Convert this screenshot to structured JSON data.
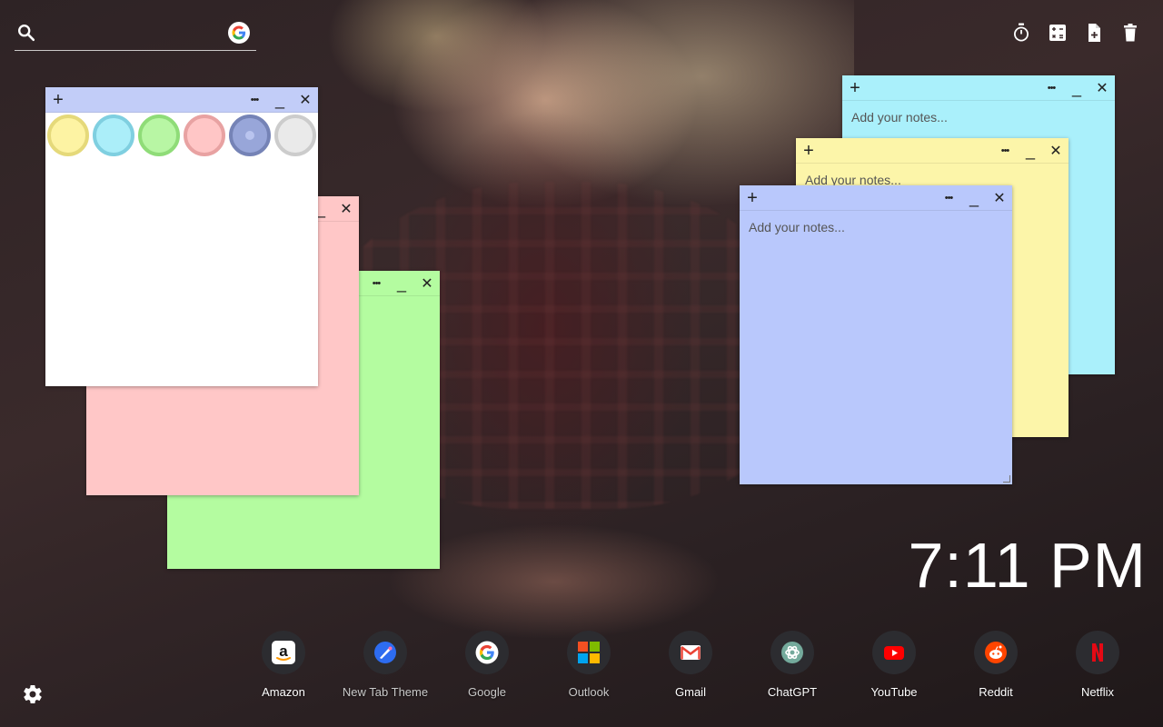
{
  "search": {
    "placeholder": ""
  },
  "tools": [
    {
      "icon": "timer-icon"
    },
    {
      "icon": "calculator-icon"
    },
    {
      "icon": "add-note-icon"
    },
    {
      "icon": "trash-icon"
    }
  ],
  "notes": {
    "add": "+",
    "more": "•••",
    "minimize": "_",
    "close": "✕",
    "placeholder": "Add your notes...",
    "colors": {
      "white": "#ffffff",
      "pink": "#ffc7c7",
      "green": "#b4fca0",
      "cyan": "#aaf0fb",
      "yellow": "#fcf5a9",
      "periwinkle": "#b9c8fc",
      "header_periwinkle": "#c2cdf8"
    }
  },
  "swatches": [
    {
      "name": "yellow",
      "fill": "#fdf3a3",
      "ring": "#e5d97a"
    },
    {
      "name": "cyan",
      "fill": "#abeef9",
      "ring": "#7fcfe0"
    },
    {
      "name": "green",
      "fill": "#b8f6a4",
      "ring": "#8fdc78"
    },
    {
      "name": "pink",
      "fill": "#ffc6c6",
      "ring": "#e8a2a2"
    },
    {
      "name": "blue",
      "fill": "#98a6d9",
      "ring": "#7583b6"
    },
    {
      "name": "grey",
      "fill": "#eaeaea",
      "ring": "#cccccc"
    }
  ],
  "clock": {
    "time": "7:11 PM"
  },
  "dock": [
    {
      "label": "Amazon"
    },
    {
      "label": "New Tab Theme"
    },
    {
      "label": "Google"
    },
    {
      "label": "Outlook"
    },
    {
      "label": "Gmail"
    },
    {
      "label": "ChatGPT"
    },
    {
      "label": "YouTube"
    },
    {
      "label": "Reddit"
    },
    {
      "label": "Netflix"
    }
  ]
}
